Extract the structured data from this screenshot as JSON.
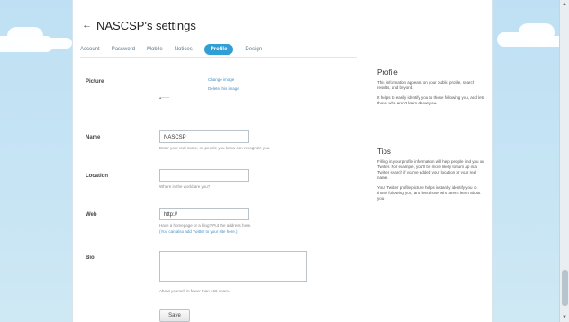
{
  "header": {
    "back_glyph": "←",
    "title": "NASCSP's settings"
  },
  "tabs": [
    {
      "label": "Account"
    },
    {
      "label": "Password"
    },
    {
      "label": "Mobile"
    },
    {
      "label": "Notices"
    },
    {
      "label": "Profile",
      "active": true
    },
    {
      "label": "Design"
    }
  ],
  "form": {
    "picture_label": "Picture",
    "picture_thumb_text": "▴——",
    "change_image_link": "Change image",
    "delete_image_link": "Delete this image",
    "name_label": "Name",
    "name_value": "NASCSP",
    "name_hint": "Enter your real name, so people you know can recognize you.",
    "location_label": "Location",
    "location_value": "",
    "location_hint": "Where in the world are you?",
    "web_label": "Web",
    "web_value": "http://",
    "web_hint_1": "Have a homepage or a blog? Put the address here.",
    "web_hint_2": "(You can also add Twitter to your site here.)",
    "bio_label": "Bio",
    "bio_value": "",
    "bio_hint": "About yourself in fewer than 160 chars.",
    "save_label": "Save"
  },
  "sidebar": {
    "profile_title": "Profile",
    "profile_text_1": "This information appears on your public profile, search results, and beyond.",
    "profile_text_2": "It helps to easily identify you to those following you, and lets those who aren't learn about you.",
    "tips_title": "Tips",
    "tips_text_1": "Filling in your profile information will help people find you on Twitter. For example, you'll be more likely to turn up in a Twitter search if you've added your location or your real name.",
    "tips_text_2": "Your Twitter profile picture helps instantly identify you to those following you, and lets those who aren't learn about you."
  },
  "colors": {
    "accent": "#2f9fd6",
    "background": "#c0deed",
    "panel": "#ffffff",
    "link": "#4b8fc0"
  }
}
